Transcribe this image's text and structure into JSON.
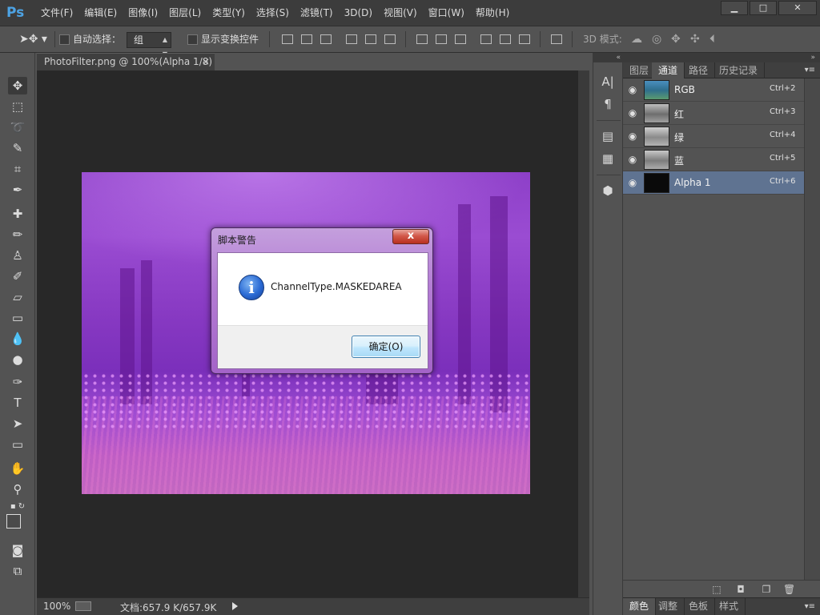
{
  "app": {
    "logo": "Ps",
    "menu": [
      "文件(F)",
      "编辑(E)",
      "图像(I)",
      "图层(L)",
      "类型(Y)",
      "选择(S)",
      "滤镜(T)",
      "3D(D)",
      "视图(V)",
      "窗口(W)",
      "帮助(H)"
    ],
    "window_controls": {
      "minimize": "▁",
      "maximize": "□",
      "close": "✕"
    }
  },
  "options_bar": {
    "auto_select_label": "自动选择：",
    "auto_select_value": "组",
    "show_transform_label": "显示变换控件",
    "mode_3d_label": "3D 模式:"
  },
  "document": {
    "tab_title": "PhotoFilter.png @ 100%(Alpha 1/8)",
    "tab_close": "×"
  },
  "status_bar": {
    "zoom": "100%",
    "doc_info": "文档:657.9 K/657.9K"
  },
  "panel": {
    "tabs": [
      "图层",
      "通道",
      "路径",
      "历史记录"
    ],
    "active_tab": "通道",
    "channels": [
      {
        "name": "RGB",
        "shortcut": "Ctrl+2",
        "selected": false
      },
      {
        "name": "红",
        "shortcut": "Ctrl+3",
        "selected": false
      },
      {
        "name": "绿",
        "shortcut": "Ctrl+4",
        "selected": false
      },
      {
        "name": "蓝",
        "shortcut": "Ctrl+5",
        "selected": false
      },
      {
        "name": "Alpha 1",
        "shortcut": "Ctrl+6",
        "selected": true
      }
    ]
  },
  "bottom_panel": {
    "tabs": [
      "颜色",
      "调整",
      "色板",
      "样式"
    ],
    "active_tab": "颜色"
  },
  "dialog": {
    "title": "脚本警告",
    "close_label": "x",
    "icon": "i",
    "message": "ChannelType.MASKEDAREA",
    "ok_label": "确定(O)"
  },
  "colors": {
    "workspace_bg": "#282828",
    "selected_channel": "#5f7391",
    "ps_logo": "#4da3e4"
  }
}
